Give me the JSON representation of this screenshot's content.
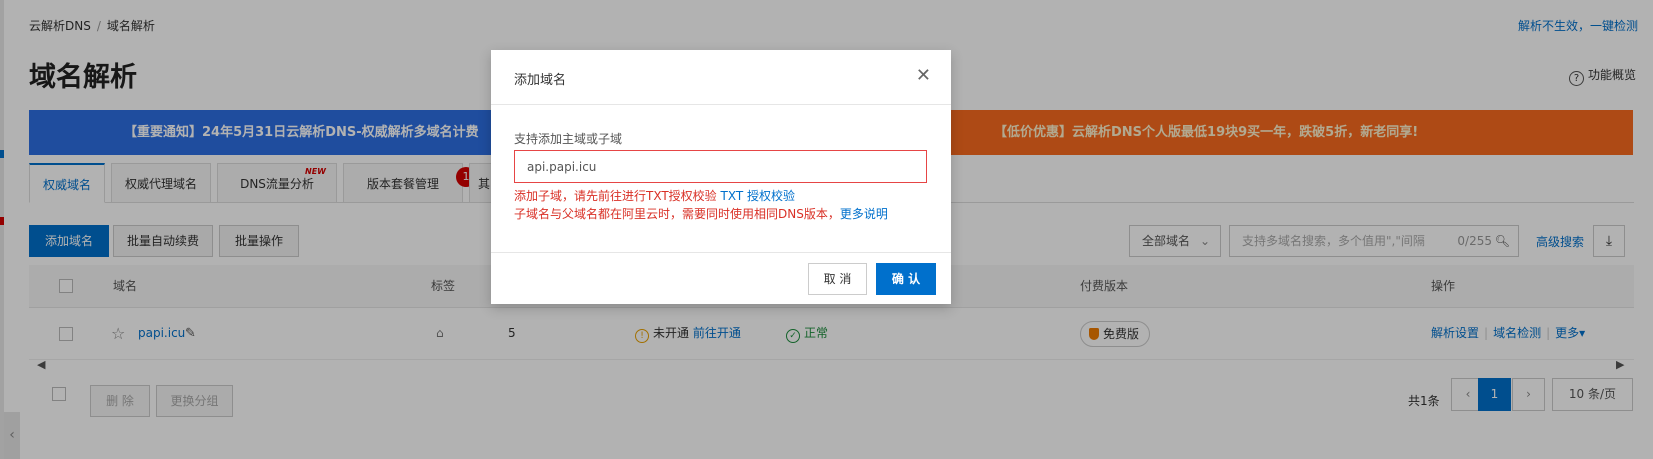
{
  "breadcrumb": [
    "云解析DNS",
    "/",
    "域名解析"
  ],
  "top_link": "解析不生效，一键检测",
  "page_title": "域名解析",
  "overview": "功能概览",
  "banners": {
    "left": "【重要通知】24年5月31日云解析DNS-权威解析多域名计费",
    "right": "【低价优惠】云解析DNS个人版最低19块9买一年，跌破5折，新老同享!"
  },
  "tabs": [
    {
      "label": "权威域名",
      "active": true
    },
    {
      "label": "权威代理域名"
    },
    {
      "label": "DNS流量分析",
      "badge": "NEW"
    },
    {
      "label": "版本套餐管理",
      "count": "1"
    },
    {
      "label": "其"
    }
  ],
  "toolbar": {
    "add_domain": "添加域名",
    "batch_renew": "批量自动续费",
    "batch_ops": "批量操作",
    "filter_select": "全部域名",
    "search_placeholder": "支持多域名搜索，多个值用\",\"间隔",
    "search_count": "0/255",
    "advanced_search": "高级搜索"
  },
  "table": {
    "headers": {
      "domain": "域名",
      "tag": "标签",
      "paid_version": "付费版本",
      "actions": "操作"
    },
    "row": {
      "domain": "papi.icu",
      "record_count": "5",
      "status1": "未开通",
      "status1_link": "前往开通",
      "status2": "正常",
      "version": "免费版",
      "actions": [
        "解析设置",
        "域名检测",
        "更多▾"
      ]
    }
  },
  "footer": {
    "delete": "删 除",
    "change_group": "更换分组",
    "total": "共1条",
    "page": "1",
    "page_size": "10 条/页"
  },
  "modal": {
    "title": "添加域名",
    "label": "支持添加主域或子域",
    "input_value": "api.papi.icu",
    "error_line1": "添加子域，请先前往进行TXT授权校验 ",
    "error_line1_link": "TXT 授权校验",
    "error_line2": "子域名与父域名都在阿里云时，需要同时使用相同DNS版本，",
    "error_line2_link": "更多说明",
    "cancel": "取 消",
    "confirm": "确 认"
  },
  "colors": {
    "primary": "#0070cc",
    "error": "#d93026",
    "banner_blue": "#2d6fe3",
    "banner_orange": "#fa6b1f"
  }
}
